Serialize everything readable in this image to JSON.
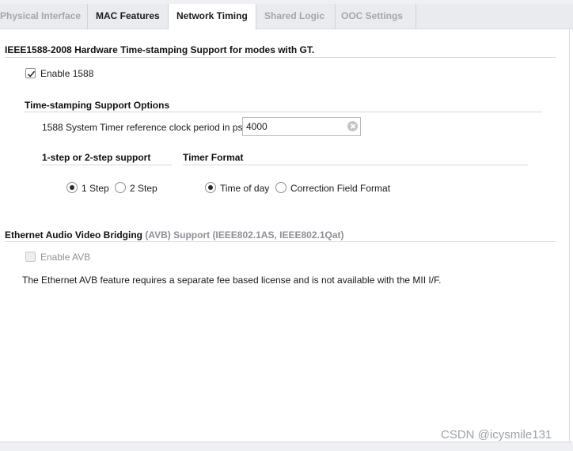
{
  "tabs": [
    {
      "label": "Physical Interface",
      "state": "dim"
    },
    {
      "label": "MAC Features",
      "state": "on"
    },
    {
      "label": "Network Timing",
      "state": "active"
    },
    {
      "label": "Shared Logic",
      "state": "dim"
    },
    {
      "label": "OOC Settings",
      "state": "dim"
    }
  ],
  "ieee1588": {
    "header": "IEEE1588-2008 Hardware Time-stamping Support for modes with GT.",
    "enable_label": "Enable 1588",
    "enable_checked": true
  },
  "timestamping": {
    "header": "Time-stamping Support Options",
    "timer_period_label": "1588 System Timer reference clock period in ps",
    "timer_period_value": "4000",
    "step_header": "1-step or 2-step support",
    "step_options": [
      "1 Step",
      "2 Step"
    ],
    "step_selected": "1 Step",
    "format_header": "Timer Format",
    "format_options": [
      "Time of day",
      "Correction Field Format"
    ],
    "format_selected": "Time of day"
  },
  "avb": {
    "header_prefix": "Ethernet Audio Video Bridging",
    "header_suffix": "(AVB) Support (IEEE802.1AS, IEEE802.1Qat)",
    "enable_label": "Enable AVB",
    "enable_checked": false,
    "note": "The Ethernet AVB feature requires a separate fee based license and is not available with the MII I/F."
  },
  "watermark": "CSDN @icysmile131",
  "icons": {
    "check": "checkmark-icon",
    "clear": "clear-icon"
  },
  "colors": {
    "tabbar_bg": "#e9ebee",
    "disabled_text": "#8c9096"
  }
}
